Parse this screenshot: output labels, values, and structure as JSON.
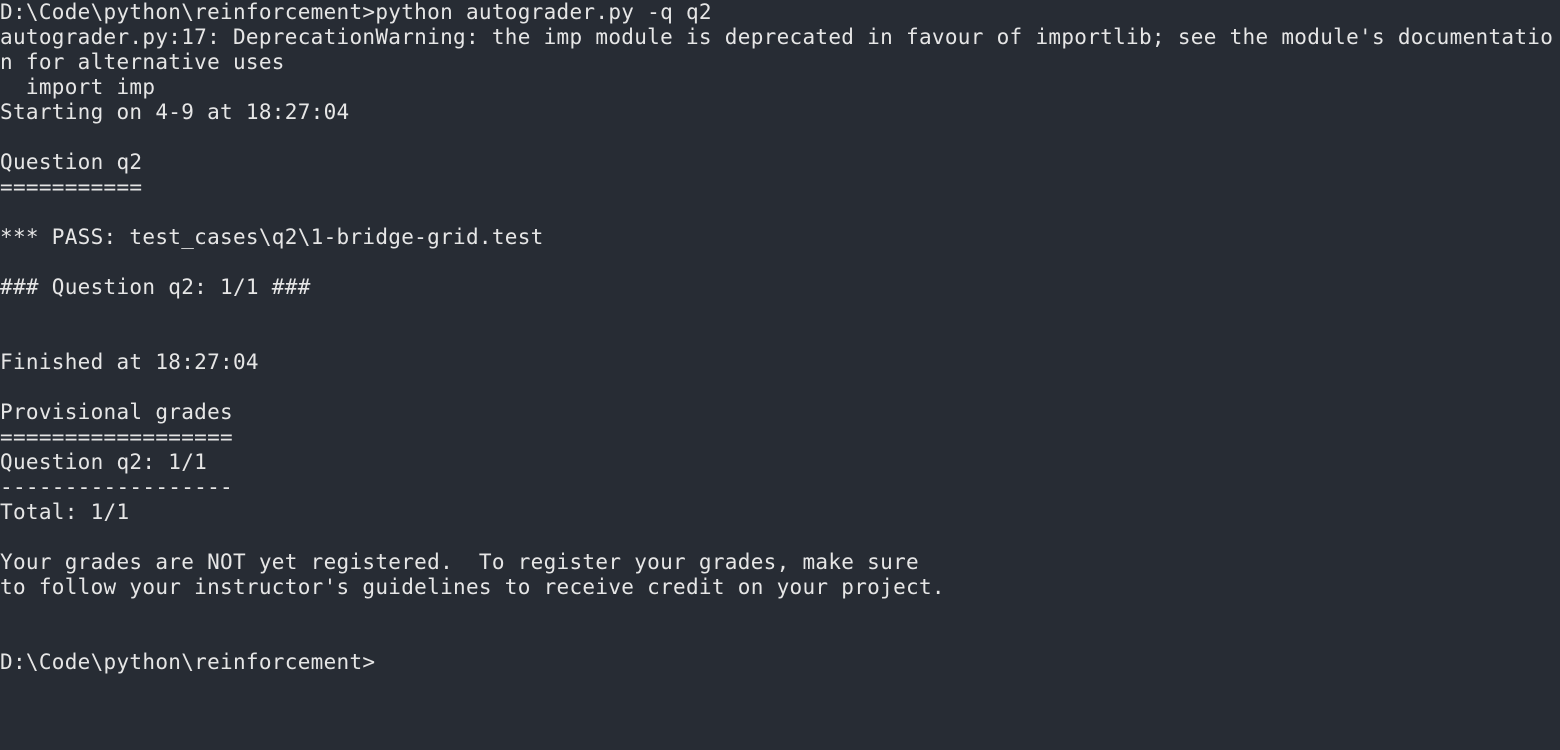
{
  "terminal": {
    "colors": {
      "background": "#272c34",
      "foreground": "#e6e6e6"
    },
    "lines": [
      "D:\\Code\\python\\reinforcement>python autograder.py -q q2",
      "autograder.py:17: DeprecationWarning: the imp module is deprecated in favour of importlib; see the module's documentatio",
      "n for alternative uses",
      "  import imp",
      "Starting on 4-9 at 18:27:04",
      "",
      "Question q2",
      "===========",
      "",
      "*** PASS: test_cases\\q2\\1-bridge-grid.test",
      "",
      "### Question q2: 1/1 ###",
      "",
      "",
      "Finished at 18:27:04",
      "",
      "Provisional grades",
      "==================",
      "Question q2: 1/1",
      "------------------",
      "Total: 1/1",
      "",
      "Your grades are NOT yet registered.  To register your grades, make sure",
      "to follow your instructor's guidelines to receive credit on your project.",
      "",
      "",
      "D:\\Code\\python\\reinforcement>"
    ]
  }
}
